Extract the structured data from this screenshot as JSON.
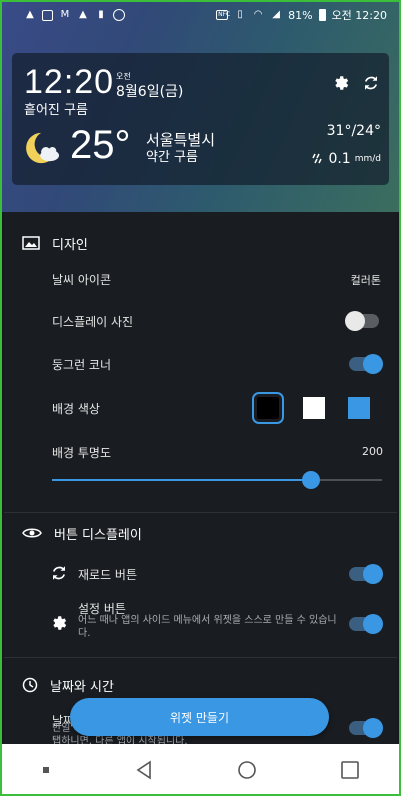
{
  "status_bar": {
    "battery": "81%",
    "time": "오전 12:20",
    "nfc_label": "NFC",
    "icons_left": [
      "warning-icon",
      "warning-icon",
      "image-icon",
      "gmail-icon",
      "warning-icon",
      "sd-card-icon",
      "chrome-icon"
    ],
    "icons_right": [
      "nfc-icon",
      "vibrate-icon",
      "wifi-icon",
      "signal-icon",
      "battery-icon"
    ]
  },
  "widget": {
    "time": "12:20",
    "ampm": "오전",
    "date": "8월6일(금)",
    "condition_top": "흩어진 구름",
    "temperature": "25°",
    "city": "서울특별시",
    "condition_bottom": "약간 구름",
    "hi_lo": "31°/24°",
    "rain_value": "0.1",
    "rain_unit": "mm/d"
  },
  "design": {
    "header": "디자인",
    "weather_icon_label": "날씨 아이콘",
    "weather_icon_value": "컬러톤",
    "display_photo_label": "디스플레이 사진",
    "display_photo_on": false,
    "rounded_corner_label": "둥그런 코너",
    "rounded_corner_on": true,
    "bg_color_label": "배경 색상",
    "bg_colors": [
      "#000000",
      "#ffffff",
      "#3a97e3"
    ],
    "bg_transparency_label": "배경 투명도",
    "bg_transparency_value": "200",
    "bg_transparency_max": 255
  },
  "button_display": {
    "header": "버튼 디스플레이",
    "reload_label": "재로드 버튼",
    "reload_on": true,
    "settings_label": "설정 버튼",
    "settings_desc": "어느 때나 앱의 사이드 메뉴에서 위젯을 스스로 만들 수 있습니다.",
    "settings_on": true
  },
  "date_time": {
    "header": "날짜와 시간",
    "row_label_partial": "날짜",
    "row_desc_partial1": "만일 시",
    "row_desc_partial2": "탭하니면, 다른 앱이 시작됩니다."
  },
  "create_widget_label": "위젯 만들기",
  "colors": {
    "accent": "#3a97e3",
    "panel_bg": "#191c20"
  }
}
